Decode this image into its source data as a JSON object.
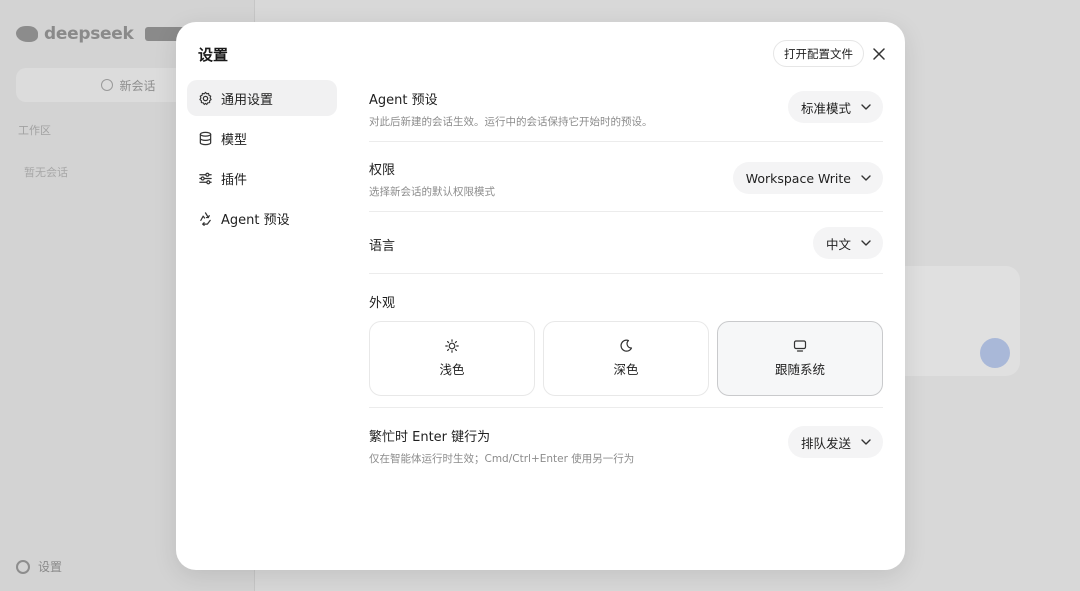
{
  "background": {
    "brand": "deepseek",
    "new_chat": "新会话",
    "workspace_label": "工作区",
    "empty_text": "暂无会话",
    "settings_label": "设置"
  },
  "modal": {
    "title": "设置",
    "open_config_label": "打开配置文件",
    "close_icon": "close-icon",
    "nav": [
      {
        "label": "通用设置",
        "icon": "gear-icon",
        "active": true
      },
      {
        "label": "模型",
        "icon": "database-icon",
        "active": false
      },
      {
        "label": "插件",
        "icon": "sliders-icon",
        "active": false
      },
      {
        "label": "Agent 预设",
        "icon": "recycle-icon",
        "active": false
      }
    ],
    "settings": {
      "agent_preset": {
        "title": "Agent 预设",
        "desc": "对此后新建的会话生效。运行中的会话保持它开始时的预设。",
        "value": "标准模式"
      },
      "permission": {
        "title": "权限",
        "desc": "选择新会话的默认权限模式",
        "value": "Workspace Write"
      },
      "language": {
        "title": "语言",
        "value": "中文"
      },
      "appearance": {
        "title": "外观",
        "options": [
          {
            "label": "浅色",
            "icon": "sun-icon",
            "selected": false
          },
          {
            "label": "深色",
            "icon": "moon-icon",
            "selected": false
          },
          {
            "label": "跟随系统",
            "icon": "monitor-icon",
            "selected": true
          }
        ]
      },
      "busy_enter": {
        "title": "繁忙时 Enter 键行为",
        "desc": "仅在智能体运行时生效；Cmd/Ctrl+Enter 使用另一行为",
        "value": "排队发送"
      }
    }
  },
  "colors": {
    "overlay_bg": "#cfcfcf",
    "modal_bg": "#ffffff",
    "active_nav_bg": "#f1f1f2",
    "select_bg": "#f4f4f5",
    "selected_theme_border": "#c9cacc",
    "muted_text": "#8c8c8c"
  }
}
